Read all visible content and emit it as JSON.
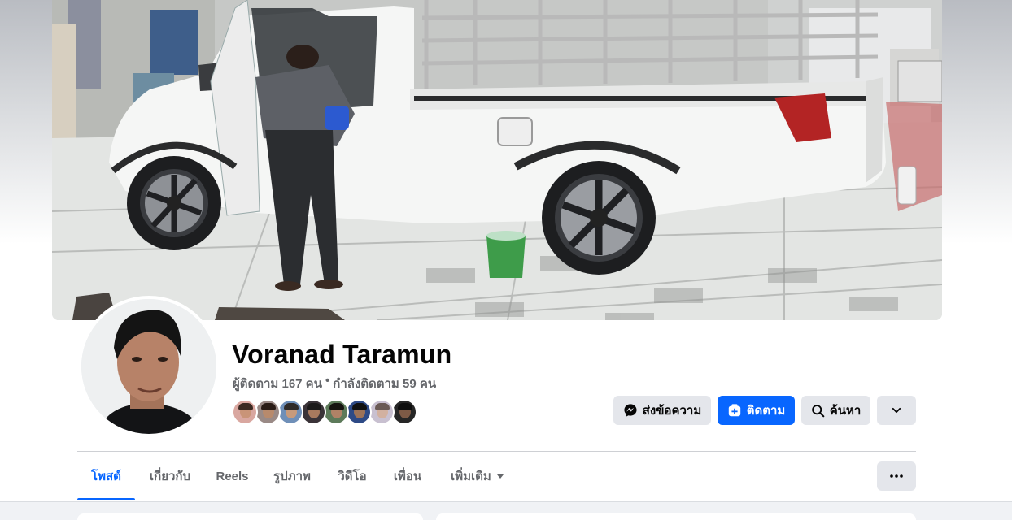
{
  "profile": {
    "name": "Voranad Taramun",
    "followers": "ผู้ติดตาม 167 คน",
    "separator": "•",
    "following": "กำลังติดตาม 59 คน"
  },
  "friends": [
    {
      "face": "#c99478",
      "hair": "#3b2a22",
      "bg": "#d9a7a0"
    },
    {
      "face": "#b88a6c",
      "hair": "#2a1c16",
      "bg": "#9a8a86"
    },
    {
      "face": "#c79a7b",
      "hair": "#2f2a28",
      "bg": "#6f8fb8"
    },
    {
      "face": "#a97a5e",
      "hair": "#1c1a1a",
      "bg": "#3a3338"
    },
    {
      "face": "#b08266",
      "hair": "#15130f",
      "bg": "#5d7a5a"
    },
    {
      "face": "#9c7258",
      "hair": "#111111",
      "bg": "#2e4a86"
    },
    {
      "face": "#d2b1a0",
      "hair": "#6a5a55",
      "bg": "#c8c0d0"
    },
    {
      "face": "#7d5a46",
      "hair": "#0e0e0e",
      "bg": "#262626"
    }
  ],
  "actions": {
    "message_label": "ส่งข้อความ",
    "follow_label": "ติดตาม",
    "search_label": "ค้นหา"
  },
  "tabs": [
    {
      "label": "โพสต์",
      "active": true
    },
    {
      "label": "เกี่ยวกับ",
      "active": false
    },
    {
      "label": "Reels",
      "active": false
    },
    {
      "label": "รูปภาพ",
      "active": false
    },
    {
      "label": "วิดีโอ",
      "active": false
    },
    {
      "label": "เพื่อน",
      "active": false
    },
    {
      "label": "เพิ่มเติม",
      "active": false
    }
  ],
  "icons": {
    "message": "messenger-icon",
    "follow": "follow-add-icon",
    "search": "search-icon",
    "dropdown": "chevron-down-icon",
    "more": "more-dots-icon"
  },
  "colors": {
    "accent": "#0866ff",
    "button_gray": "#e4e6eb",
    "text_secondary": "#65676b"
  }
}
